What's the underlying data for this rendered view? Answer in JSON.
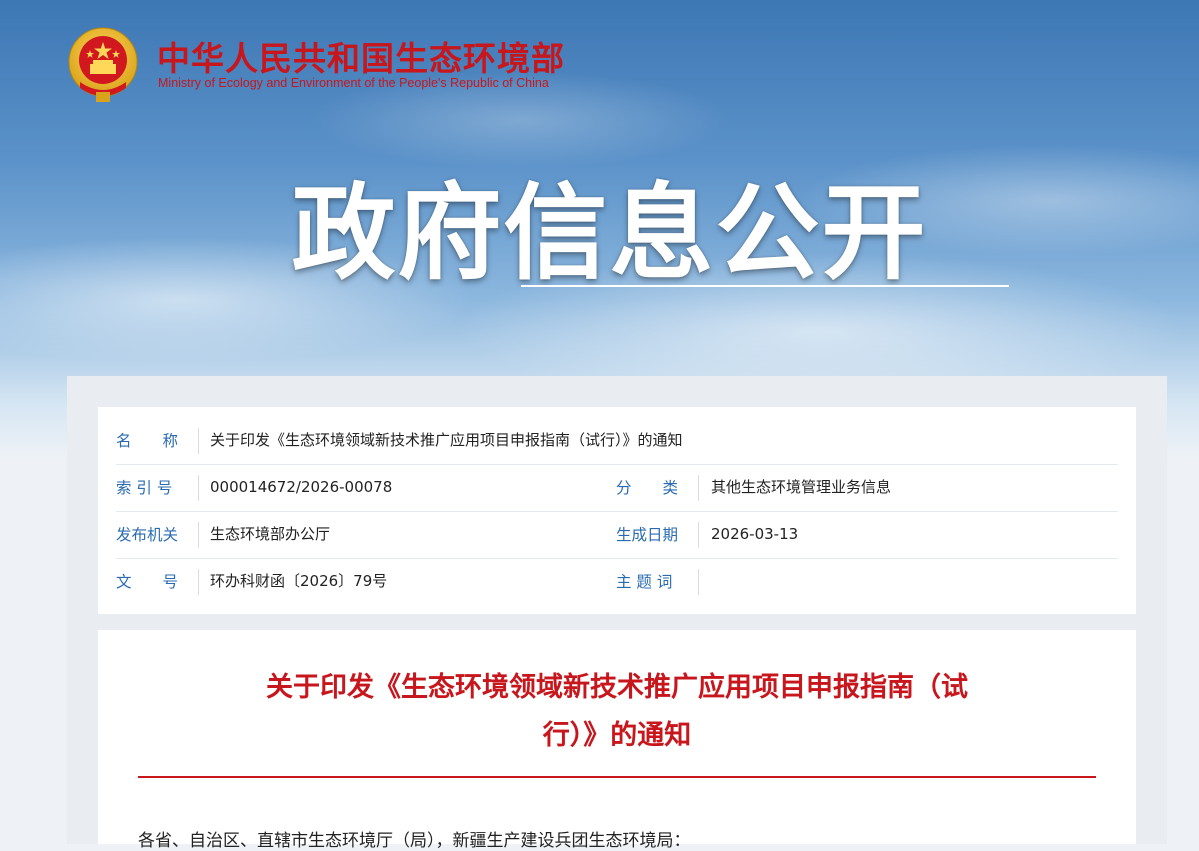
{
  "header": {
    "ministry_cn": "中华人民共和国生态环境部",
    "ministry_en": "Ministry of Ecology and Environment of the People's Republic of China",
    "banner_title": "政府信息公开"
  },
  "info": {
    "name_label": "名　　称",
    "name_value": "关于印发《生态环境领域新技术推广应用项目申报指南（试行）》的通知",
    "index_label": "索 引 号",
    "index_value": "000014672/2026-00078",
    "category_label": "分　　类",
    "category_value": "其他生态环境管理业务信息",
    "issuer_label": "发布机关",
    "issuer_value": "生态环境部办公厅",
    "date_label": "生成日期",
    "date_value": "2026-03-13",
    "docno_label": "文　　号",
    "docno_value": "环办科财函〔2026〕79号",
    "keywords_label": "主 题 词",
    "keywords_value": ""
  },
  "article": {
    "title_line1": "关于印发《生态环境领域新技术推广应用项目申报指南（试",
    "title_line2": "行）》的通知",
    "salutation": "各省、自治区、直辖市生态环境厅（局），新疆生产建设兵团生态环境局："
  },
  "colors": {
    "brand_red": "#c8161d",
    "label_blue": "#2a6bb0"
  }
}
